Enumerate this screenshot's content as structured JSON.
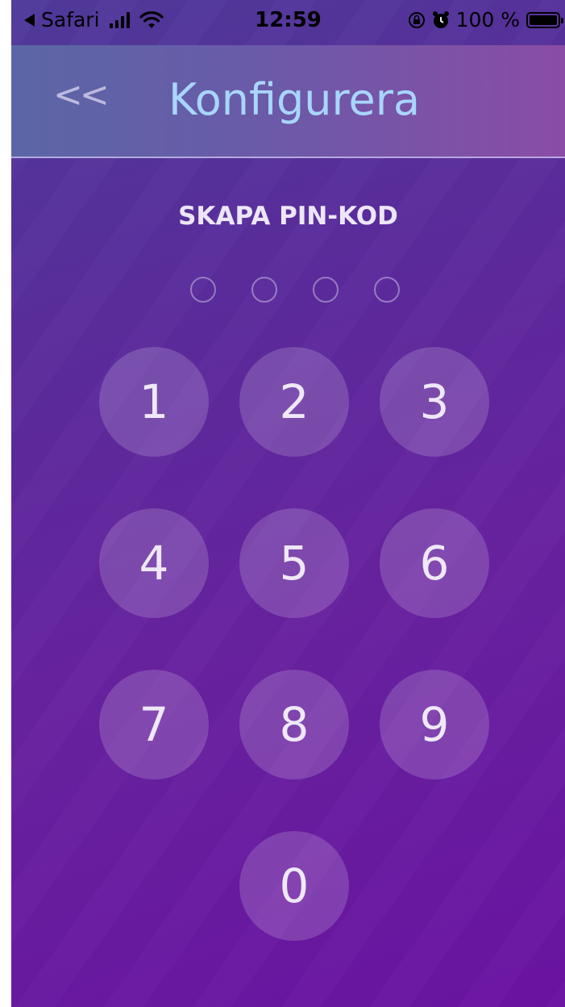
{
  "status_bar": {
    "back_app": "Safari",
    "time": "12:59",
    "battery_percent": "100 %",
    "icons": [
      "back-triangle-icon",
      "signal-bars-icon",
      "wifi-icon",
      "rotation-lock-icon",
      "alarm-icon",
      "battery-icon"
    ]
  },
  "header": {
    "back_label": "<<",
    "title": "Konfigurera"
  },
  "pin": {
    "label": "SKAPA PIN-KOD",
    "digits_total": 4,
    "digits_entered": 0
  },
  "keypad": {
    "keys": [
      "1",
      "2",
      "3",
      "4",
      "5",
      "6",
      "7",
      "8",
      "9",
      "0"
    ]
  },
  "colors": {
    "title": "#a8d6ff",
    "background_top": "#4f3a9a",
    "background_bottom": "#6a13a3"
  }
}
